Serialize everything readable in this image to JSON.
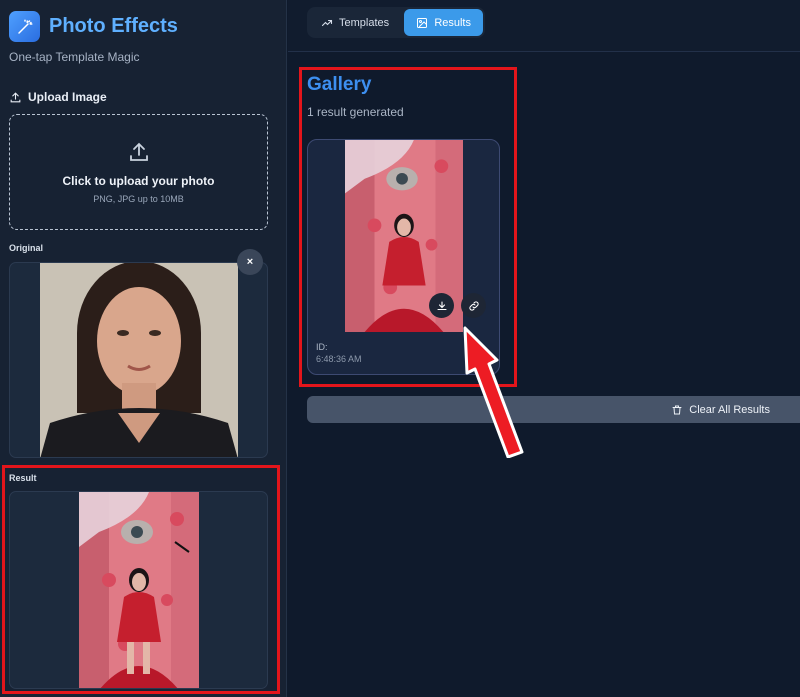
{
  "app": {
    "title": "Photo Effects",
    "tagline": "One-tap Template Magic"
  },
  "upload": {
    "section_label": "Upload Image",
    "title": "Click to upload your photo",
    "hint": "PNG, JPG up to 10MB"
  },
  "original": {
    "label": "Original",
    "close_symbol": "×"
  },
  "result": {
    "label": "Result"
  },
  "tabs": [
    {
      "label": "Templates",
      "icon": "trending-up-icon",
      "active": false
    },
    {
      "label": "Results",
      "icon": "image-icon",
      "active": true
    }
  ],
  "gallery": {
    "title": "Gallery",
    "count_text": "1 result generated",
    "item": {
      "id_label": "ID:",
      "time": "6:48:36 AM"
    },
    "clear_label": "Clear All Results"
  },
  "colors": {
    "accent": "#3b9aea",
    "brand": "#5fb0ff",
    "highlight": "#e3151b"
  }
}
